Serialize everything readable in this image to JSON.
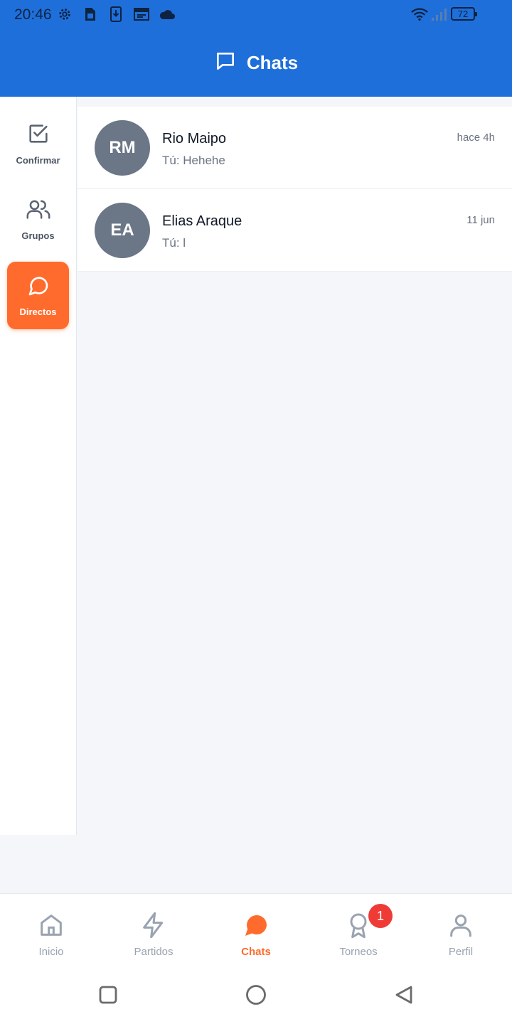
{
  "status_bar": {
    "time": "20:46",
    "battery": "72",
    "icons": [
      "settings-icon",
      "sim-icon",
      "download-icon",
      "calendar-icon",
      "cloud-icon",
      "wifi-icon",
      "signal-icon",
      "battery-icon"
    ]
  },
  "header": {
    "title": "Chats",
    "icon": "chat-bubble-icon",
    "background": "#1f6fdb"
  },
  "sidebar": {
    "items": [
      {
        "label": "Confirmar",
        "icon": "checkbox-icon",
        "active": false
      },
      {
        "label": "Grupos",
        "icon": "users-icon",
        "active": false
      },
      {
        "label": "Directos",
        "icon": "message-circle-icon",
        "active": true
      }
    ],
    "accent": "#ff6b2c"
  },
  "chats": [
    {
      "initials": "RM",
      "name": "Rio Maipo",
      "preview": "Tú: Hehehe",
      "time": "hace 4h"
    },
    {
      "initials": "EA",
      "name": "Elias Araque",
      "preview": "Tú: l",
      "time": "11 jun"
    }
  ],
  "bottom_nav": {
    "items": [
      {
        "label": "Inicio",
        "icon": "home-icon",
        "active": false
      },
      {
        "label": "Partidos",
        "icon": "lightning-icon",
        "active": false
      },
      {
        "label": "Chats",
        "icon": "chat-filled-icon",
        "active": true
      },
      {
        "label": "Torneos",
        "icon": "award-icon",
        "active": false,
        "badge": "1"
      },
      {
        "label": "Perfil",
        "icon": "user-icon",
        "active": false
      }
    ]
  },
  "system_nav": {
    "icons": [
      "recents-square-icon",
      "home-circle-icon",
      "back-triangle-icon"
    ]
  }
}
